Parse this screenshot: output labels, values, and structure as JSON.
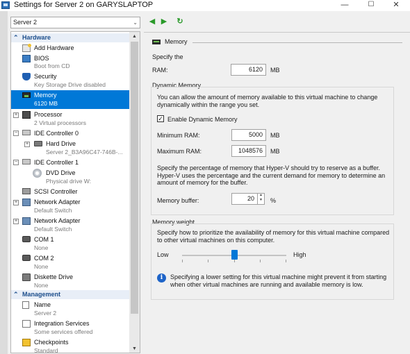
{
  "window": {
    "title": "Settings for Server 2 on GARYSLAPTOP",
    "minimize": "—",
    "maximize": "☐",
    "close": "✕"
  },
  "server_select": {
    "value": "Server 2",
    "caret": "⌄"
  },
  "nav": {
    "back": "◀",
    "forward": "▶",
    "refresh": "↻"
  },
  "tree": {
    "hardware_label": "Hardware",
    "management_label": "Management",
    "chevron": "⌃",
    "items": [
      {
        "name": "Add Hardware",
        "sub": ""
      },
      {
        "name": "BIOS",
        "sub": "Boot from CD"
      },
      {
        "name": "Security",
        "sub": "Key Storage Drive disabled"
      },
      {
        "name": "Memory",
        "sub": "6120 MB"
      },
      {
        "name": "Processor",
        "sub": "2 Virtual processors"
      },
      {
        "name": "IDE Controller 0",
        "sub": ""
      },
      {
        "name": "Hard Drive",
        "sub": "Server 2_B3A96C47-746B-..."
      },
      {
        "name": "IDE Controller 1",
        "sub": ""
      },
      {
        "name": "DVD Drive",
        "sub": "Physical drive W:"
      },
      {
        "name": "SCSI Controller",
        "sub": ""
      },
      {
        "name": "Network Adapter",
        "sub": "Default Switch"
      },
      {
        "name": "Network Adapter",
        "sub": "Default Switch"
      },
      {
        "name": "COM 1",
        "sub": "None"
      },
      {
        "name": "COM 2",
        "sub": "None"
      },
      {
        "name": "Diskette Drive",
        "sub": "None"
      }
    ],
    "mgmt_items": [
      {
        "name": "Name",
        "sub": "Server 2"
      },
      {
        "name": "Integration Services",
        "sub": "Some services offered"
      },
      {
        "name": "Checkpoints",
        "sub": "Standard"
      }
    ],
    "plus": "+",
    "minus": "−"
  },
  "memory": {
    "header": "Memory",
    "specify_line1": "Specify the",
    "ram_label": "RAM:",
    "ram_value": "6120",
    "unit": "MB",
    "dyn_title": "Dynamic Memory",
    "dyn_desc": "You can allow the amount of memory available to this virtual machine to change dynamically within the range you set.",
    "enable_dyn_label": "Enable Dynamic Memory",
    "enable_dyn_checked": true,
    "check_mark": "✓",
    "min_label": "Minimum RAM:",
    "min_value": "5000",
    "max_label": "Maximum RAM:",
    "max_value": "1048576",
    "buffer_desc": "Specify the percentage of memory that Hyper-V should try to reserve as a buffer. Hyper-V uses the percentage and the current demand for memory to determine an amount of memory for the buffer.",
    "buffer_label": "Memory buffer:",
    "buffer_value": "20",
    "buffer_unit": "%",
    "spin_up": "▲",
    "spin_down": "▼",
    "weight_title": "Memory weight",
    "weight_desc": "Specify how to prioritize the availability of memory for this virtual machine compared to other virtual machines on this computer.",
    "low": "Low",
    "high": "High",
    "weight_fraction": 0.5,
    "info_glyph": "i",
    "info_text": "Specifying a lower setting for this virtual machine might prevent it from starting when other virtual machines are running and available memory is low."
  },
  "colors": {
    "selection": "#0078d7",
    "accent_blue": "#1c4e8c",
    "nav_green": "#2a9a2a"
  }
}
